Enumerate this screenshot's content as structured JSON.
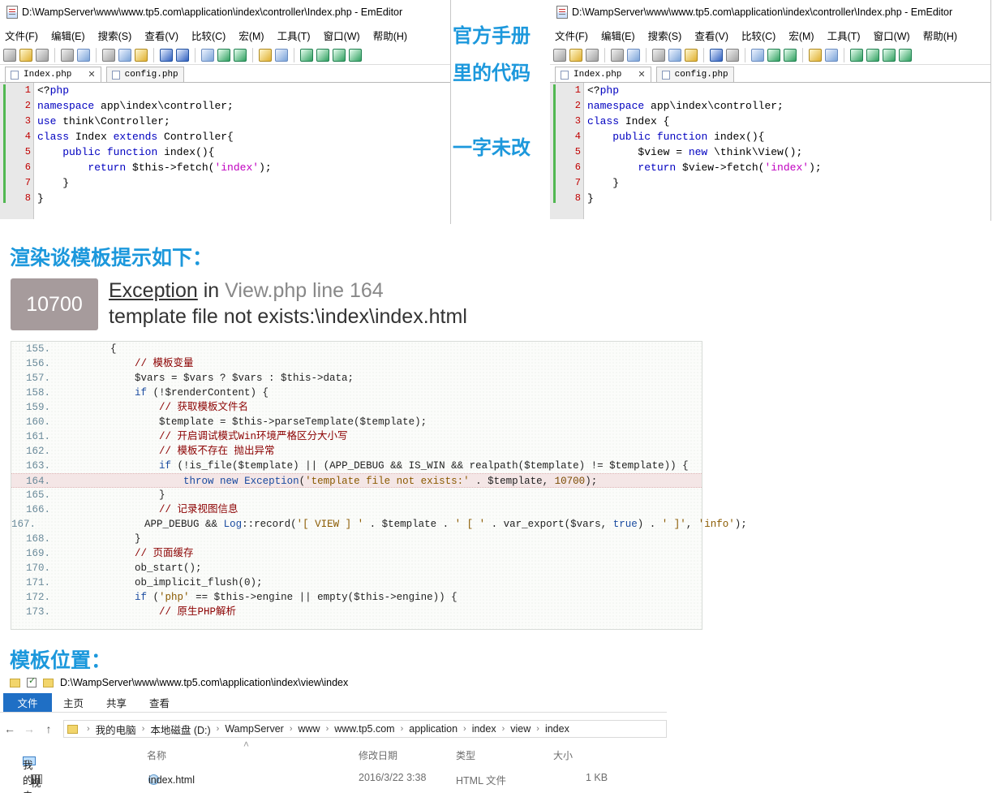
{
  "editor_left": {
    "title": "D:\\WampServer\\www\\www.tp5.com\\application\\index\\controller\\Index.php - EmEditor",
    "menu": [
      "文件(F)",
      "编辑(E)",
      "搜索(S)",
      "查看(V)",
      "比较(C)",
      "宏(M)",
      "工具(T)",
      "窗口(W)",
      "帮助(H)"
    ],
    "tabs": [
      "Index.php",
      "config.php"
    ],
    "tab_close": "✕",
    "line_numbers": [
      "1",
      "2",
      "3",
      "4",
      "5",
      "6",
      "7",
      "8"
    ]
  },
  "editor_right": {
    "title": "D:\\WampServer\\www\\www.tp5.com\\application\\index\\controller\\Index.php - EmEditor",
    "menu": [
      "文件(F)",
      "编辑(E)",
      "搜索(S)",
      "查看(V)",
      "比较(C)",
      "宏(M)",
      "工具(T)",
      "窗口(W)",
      "帮助(H)"
    ],
    "tabs": [
      "Index.php",
      "config.php"
    ],
    "tab_close": "✕",
    "line_numbers": [
      "1",
      "2",
      "3",
      "4",
      "5",
      "6",
      "7",
      "8"
    ]
  },
  "annotations": {
    "line1": "官方手册",
    "line2": "里的代码",
    "line3": "一字未改",
    "render_heading": "渲染谈模板提示如下：",
    "location_heading": "模板位置："
  },
  "exception": {
    "code": "10700",
    "type": "Exception",
    "in": "in",
    "location": "View.php line 164",
    "message": "template file not exists:\\index\\index.html"
  },
  "source_lines": [
    "155.",
    "156.",
    "157.",
    "158.",
    "159.",
    "160.",
    "161.",
    "162.",
    "163.",
    "164.",
    "165.",
    "166.",
    "167.",
    "168.",
    "169.",
    "170.",
    "171.",
    "172.",
    "173."
  ],
  "explorer": {
    "title_path": "D:\\WampServer\\www\\www.tp5.com\\application\\index\\view\\index",
    "ribbon": [
      "文件",
      "主页",
      "共享",
      "查看"
    ],
    "breadcrumbs": [
      "我的电脑",
      "本地磁盘 (D:)",
      "WampServer",
      "www",
      "www.tp5.com",
      "application",
      "index",
      "view",
      "index"
    ],
    "columns": [
      "名称",
      "修改日期",
      "类型",
      "大小"
    ],
    "sidebar": [
      "我的电脑",
      "视频"
    ],
    "file": {
      "name": "index.html",
      "date": "2016/3/22 3:38",
      "type": "HTML 文件",
      "size": "1 KB"
    }
  }
}
